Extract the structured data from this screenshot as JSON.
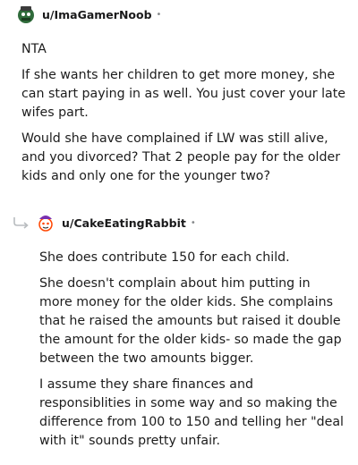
{
  "comments": [
    {
      "username": "u/ImaGamerNoob",
      "dot": "•",
      "paragraphs": [
        "NTA",
        "If she wants her children to get more money, she can start paying in as well. You just cover your late wifes part.",
        "Would she have complained if LW was still alive, and you divorced? That 2 people pay for the older kids and only one for the younger two?"
      ]
    },
    {
      "username": "u/CakeEatingRabbit",
      "dot": "•",
      "paragraphs": [
        "She does contribute 150 for each child.",
        "She doesn't complain about him putting in more money for the older kids. She complains that he raised the amounts but raised it double the amount for the older kids- so made the gap between the two amounts bigger.",
        "I assume they share finances and responsiblities in some way and so making the difference from 100 to 150 and telling her \"deal with it\" sounds pretty unfair."
      ]
    }
  ]
}
